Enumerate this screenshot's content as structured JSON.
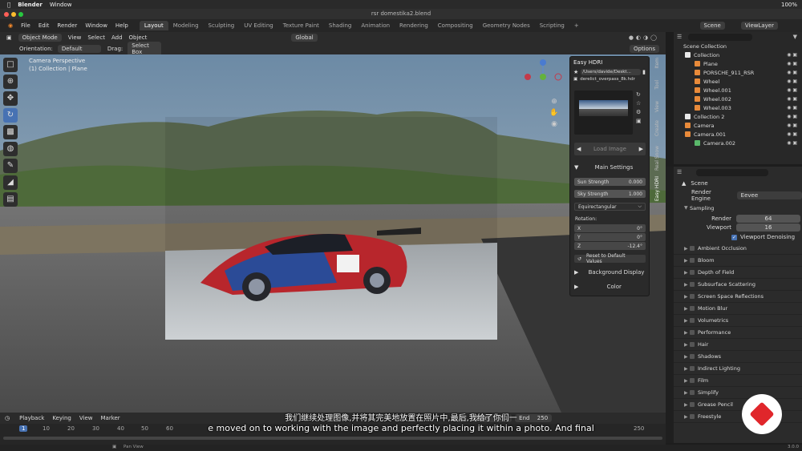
{
  "mac": {
    "app": "Blender",
    "menu": "Window",
    "battery": "100%",
    "time": "10:40"
  },
  "window_title": "rsr domestika2.blend",
  "menus": [
    "File",
    "Edit",
    "Render",
    "Window",
    "Help"
  ],
  "workspaces": [
    "Layout",
    "Modeling",
    "Sculpting",
    "UV Editing",
    "Texture Paint",
    "Shading",
    "Animation",
    "Rendering",
    "Compositing",
    "Geometry Nodes",
    "Scripting"
  ],
  "scene": {
    "label": "Scene",
    "view_layer": "ViewLayer"
  },
  "header": {
    "mode": "Object Mode",
    "view": "View",
    "select": "Select",
    "add": "Add",
    "object": "Object",
    "transform": "Global"
  },
  "toolheader": {
    "orientation_label": "Orientation:",
    "orientation": "Default",
    "drag_label": "Drag:",
    "drag": "Select Box",
    "options": "Options"
  },
  "viewport": {
    "camera": "Camera Perspective",
    "collection": "(1) Collection | Plane"
  },
  "hdri_panel": {
    "title": "Easy HDRI",
    "path": "/Users/davide/Deskt...",
    "file": "derelict_overpass_8k.hdr",
    "load_image": "Load Image",
    "main_settings": "Main Settings",
    "sun_strength_label": "Sun Strength",
    "sun_strength": "0.000",
    "sky_strength_label": "Sky Strength",
    "sky_strength": "1.000",
    "projection": "Equirectangular",
    "rotation_label": "Rotation:",
    "rx_label": "X",
    "rx": "0°",
    "ry_label": "Y",
    "ry": "0°",
    "rz_label": "Z",
    "rz": "-12.4°",
    "reset": "Reset to Default Values",
    "background_display": "Background Display",
    "color": "Color"
  },
  "side_tabs": [
    "Item",
    "Tool",
    "View",
    "Create",
    "Real Snow",
    "Easy HDRI"
  ],
  "outliner": {
    "title": "Scene Collection",
    "items": [
      {
        "label": "Collection",
        "indent": 0,
        "color": "#e9e9e9"
      },
      {
        "label": "Plane",
        "indent": 1,
        "color": "#e88a3a"
      },
      {
        "label": "PORSCHE_911_RSR",
        "indent": 1,
        "color": "#e88a3a"
      },
      {
        "label": "Wheel",
        "indent": 1,
        "color": "#e88a3a"
      },
      {
        "label": "Wheel.001",
        "indent": 1,
        "color": "#e88a3a"
      },
      {
        "label": "Wheel.002",
        "indent": 1,
        "color": "#e88a3a"
      },
      {
        "label": "Wheel.003",
        "indent": 1,
        "color": "#e88a3a"
      },
      {
        "label": "Collection 2",
        "indent": 0,
        "color": "#e9e9e9"
      },
      {
        "label": "Camera",
        "indent": 0,
        "color": "#e88a3a"
      },
      {
        "label": "Camera.001",
        "indent": 0,
        "color": "#e88a3a"
      },
      {
        "label": "Camera.002",
        "indent": 1,
        "color": "#5ab86a"
      }
    ]
  },
  "properties": {
    "scene": "Scene",
    "render_engine_label": "Render Engine",
    "render_engine": "Eevee",
    "sampling": "Sampling",
    "render_label": "Render",
    "render_value": "64",
    "viewport_label": "Viewport",
    "viewport_value": "16",
    "viewport_denoising": "Viewport Denoising",
    "sections": [
      "Ambient Occlusion",
      "Bloom",
      "Depth of Field",
      "Subsurface Scattering",
      "Screen Space Reflections",
      "Motion Blur",
      "Volumetrics",
      "Performance",
      "Hair",
      "Shadows",
      "Indirect Lighting",
      "Film",
      "Simplify",
      "Grease Pencil",
      "Freestyle"
    ]
  },
  "timeline": {
    "playback": "Playback",
    "keying": "Keying",
    "view": "View",
    "marker": "Marker",
    "start_label": "Start",
    "start": "1",
    "end_label": "End",
    "end": "250",
    "frame": "1",
    "frames": [
      "1",
      "10",
      "20",
      "30",
      "40",
      "50",
      "60",
      "250"
    ]
  },
  "status": {
    "pan": "Pan View",
    "version": "3.0.0"
  },
  "subtitles": {
    "zh": "我们继续处理图像,并将其完美地放置在照片中,最后,我给了你们一",
    "en": "e moved on to working with the image and perfectly placing it within a photo. And final"
  }
}
